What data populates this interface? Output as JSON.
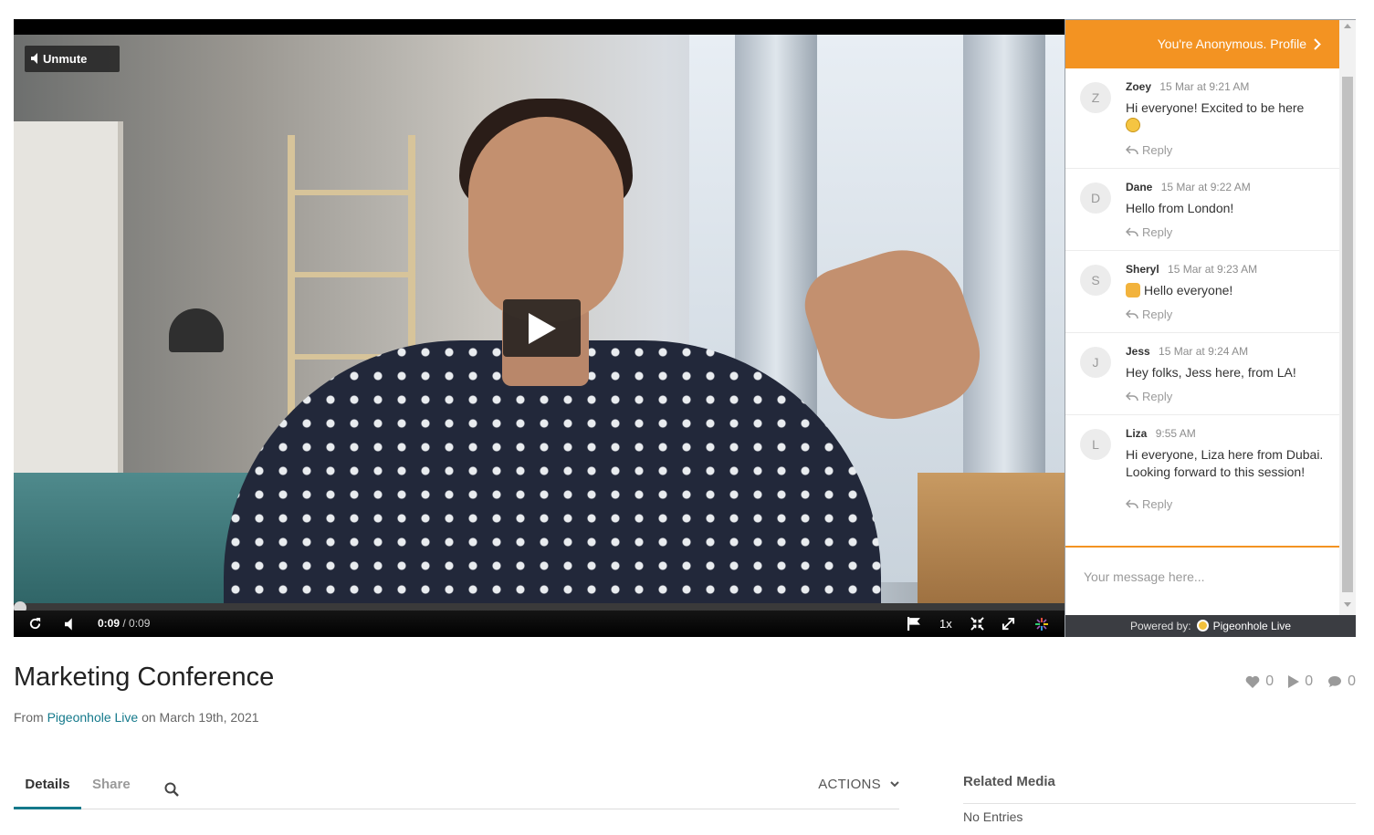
{
  "player": {
    "unmute_label": "Unmute",
    "current_time": "0:09",
    "duration": "/ 0:09",
    "speed": "1x",
    "progress_fraction": 0.0
  },
  "chat": {
    "header": "You're Anonymous. Profile",
    "compose_placeholder": "Your message here...",
    "powered_by_label": "Powered by:",
    "powered_by_brand": "Pigeonhole Live",
    "reply_label": "Reply",
    "messages": [
      {
        "initial": "Z",
        "name": "Zoey",
        "time": "15 Mar at 9:21 AM",
        "text": "Hi everyone! Excited to be here",
        "emoji": "smiling-face"
      },
      {
        "initial": "D",
        "name": "Dane",
        "time": "15 Mar at 9:22 AM",
        "text": "Hello from London!"
      },
      {
        "initial": "S",
        "name": "Sheryl",
        "time": "15 Mar at 9:23 AM",
        "text": "Hello everyone!",
        "emoji": "waving-hand"
      },
      {
        "initial": "J",
        "name": "Jess",
        "time": "15 Mar at 9:24 AM",
        "text": "Hey folks, Jess here, from LA!"
      },
      {
        "initial": "L",
        "name": "Liza",
        "time": "9:55 AM",
        "text": "Hi everyone, Liza here from Dubai. Looking forward to this session!"
      }
    ]
  },
  "media": {
    "title": "Marketing Conference",
    "from_prefix": "From",
    "owner": "Pigeonhole Live",
    "date_text": "on March 19th, 2021",
    "likes": "0",
    "plays": "0",
    "comments": "0"
  },
  "tabs": {
    "details": "Details",
    "share": "Share",
    "actions": "ACTIONS"
  },
  "related": {
    "heading": "Related Media",
    "empty": "No Entries"
  },
  "colors": {
    "accent_orange": "#f39322",
    "link_teal": "#14798b"
  }
}
